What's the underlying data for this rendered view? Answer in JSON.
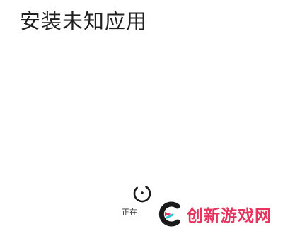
{
  "header": {
    "title": "安装未知应用"
  },
  "loading": {
    "label": "正在",
    "icon": "spinner-icon"
  },
  "watermark": {
    "text": "创新游戏网",
    "icon": "brand-logo-icon",
    "color": "#e8335f"
  },
  "colors": {
    "background": "#ffffff",
    "title": "#1f1f1f",
    "accent": "#e8335f",
    "logo_dark": "#1a1a1a",
    "logo_cyan": "#29c6d9"
  }
}
